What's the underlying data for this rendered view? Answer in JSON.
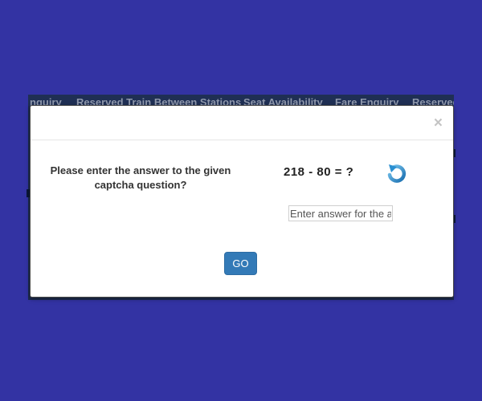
{
  "background_nav": {
    "items": [
      "nquiry",
      "Reserved Train Between Stations",
      "Seat Availability",
      "Fare Enquiry",
      "Reserved"
    ]
  },
  "modal": {
    "close_label": "×",
    "question": "Please enter the answer to the given captcha question?",
    "captcha": "218 - 80 = ?",
    "refresh_icon": "refresh-icon",
    "input_placeholder": "Enter answer for the above",
    "input_value": "",
    "go_label": "GO"
  },
  "colors": {
    "page_background": "#3333a3",
    "button_primary": "#337ab7",
    "refresh_icon": "#2a8fd1"
  }
}
